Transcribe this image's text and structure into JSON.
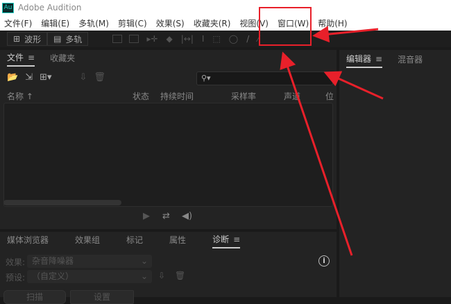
{
  "app": {
    "logo": "Au",
    "title": "Adobe Audition"
  },
  "menu": [
    "文件(F)",
    "编辑(E)",
    "多轨(M)",
    "剪辑(C)",
    "效果(S)",
    "收藏夹(R)",
    "视图(V)",
    "窗口(W)",
    "帮助(H)"
  ],
  "toolbar": {
    "waveform": "波形",
    "multitrack": "多轨"
  },
  "files_panel": {
    "tabs": [
      "文件",
      "收藏夹"
    ],
    "search_placeholder": "⚲▾",
    "columns": [
      "名称 ↑",
      "状态",
      "持续时间",
      "采样率",
      "声道",
      "位"
    ]
  },
  "editor_panel": {
    "tabs": [
      "编辑器",
      "混音器"
    ]
  },
  "bottom_panel": {
    "tabs": [
      "媒体浏览器",
      "效果组",
      "标记",
      "属性",
      "诊断"
    ],
    "effect_label": "效果:",
    "effect_value": "杂音降噪器",
    "preset_label": "预设:",
    "preset_value": "（自定义）",
    "buttons": [
      "扫描",
      "设置"
    ]
  },
  "annotation": {
    "color": "#e8202a"
  }
}
